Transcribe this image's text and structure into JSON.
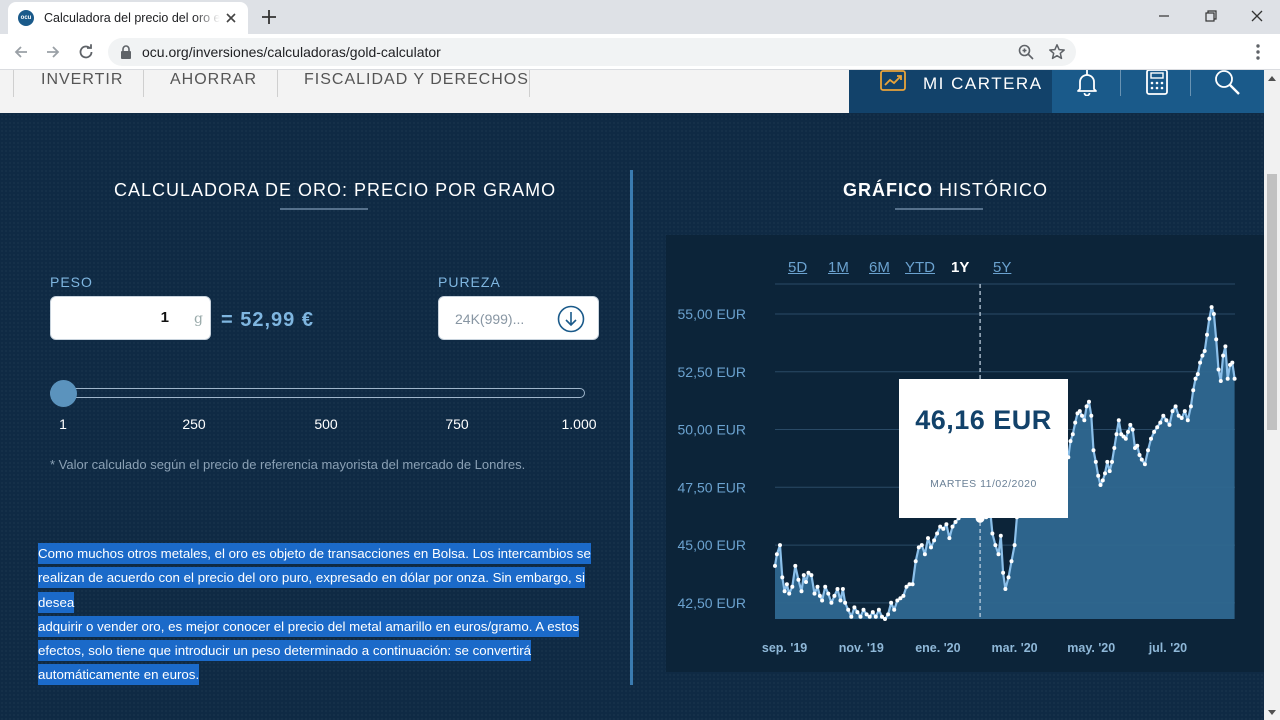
{
  "browser": {
    "tab_title": "Calculadora del precio del oro en",
    "favicon_text": "ocu",
    "url": "ocu.org/inversiones/calculadoras/gold-calculator"
  },
  "site_nav": {
    "items": [
      "INVERTIR",
      "AHORRAR",
      "FISCALIDAD Y DERECHOS"
    ],
    "cartera_label": "MI CARTERA"
  },
  "calculator": {
    "title": "CALCULADORA DE ORO: PRECIO POR GRAMO",
    "peso_label": "PESO",
    "peso_value": "1",
    "peso_unit": "g",
    "result": "= 52,99 €",
    "pureza_label": "PUREZA",
    "pureza_value": "24K(999)...",
    "slider_value": 1,
    "slider_ticks": [
      "1",
      "250",
      "500",
      "750",
      "1.000"
    ],
    "footnote": "* Valor calculado según el precio de referencia mayorista del mercado de Londres.",
    "paragraph_lines": [
      "Como muchos otros metales, el oro es objeto de transacciones en Bolsa. Los intercambios se",
      "realizan de acuerdo con el precio del oro puro, expresado en dólar por onza. Sin embargo, si desea",
      "adquirir o vender oro, es mejor conocer el precio del metal amarillo en euros/gramo. A estos",
      "efectos, solo tiene que introducir un peso determinado a continuación: se convertirá",
      "automáticamente en euros."
    ]
  },
  "history": {
    "title_bold": "GRÁFICO",
    "title_rest": " HISTÓRICO",
    "ranges": [
      "5D",
      "1M",
      "6M",
      "YTD",
      "1Y",
      "5Y"
    ],
    "active_range": "1Y",
    "tooltip_value": "46,16 EUR",
    "tooltip_date": "MARTES 11/02/2020"
  },
  "chart_data": {
    "type": "area",
    "y_unit": "EUR",
    "y_ticks": [
      "55,00 EUR",
      "52,50 EUR",
      "50,00 EUR",
      "47,50 EUR",
      "45,00 EUR",
      "42,50 EUR"
    ],
    "y_tick_values": [
      55,
      52.5,
      50,
      47.5,
      45,
      42.5
    ],
    "ylim": [
      41.8,
      56.3
    ],
    "x_ticks": [
      "sep. '19",
      "nov. '19",
      "ene. '20",
      "mar. '20",
      "may. '20",
      "jul. '20"
    ],
    "x_tick_months": [
      0,
      2,
      4,
      6,
      8,
      10
    ],
    "x_range_months": [
      -0.25,
      11.75
    ],
    "grid": true,
    "series": [
      {
        "months": [
          -0.25,
          -0.2,
          -0.12,
          -0.06,
          0.0,
          0.06,
          0.12,
          0.2,
          0.28,
          0.36,
          0.44,
          0.5,
          0.56,
          0.62,
          0.7,
          0.78,
          0.86,
          0.92,
          0.98,
          1.06,
          1.14,
          1.22,
          1.3,
          1.38,
          1.46,
          1.52,
          1.58,
          1.66,
          1.74,
          1.82,
          1.9,
          1.98,
          2.06,
          2.14,
          2.22,
          2.3,
          2.38,
          2.46,
          2.54,
          2.62,
          2.7,
          2.78,
          2.86,
          2.94,
          3.02,
          3.1,
          3.18,
          3.26,
          3.34,
          3.42,
          3.5,
          3.58,
          3.66,
          3.74,
          3.82,
          3.9,
          3.98,
          4.06,
          4.14,
          4.22,
          4.3,
          4.38,
          4.46,
          4.54,
          4.62,
          4.7,
          4.78,
          4.86,
          4.94,
          5.02,
          5.1,
          5.18,
          5.26,
          5.34,
          5.36,
          5.42,
          5.5,
          5.58,
          5.64,
          5.7,
          5.76,
          5.84,
          5.92,
          6.0,
          6.06,
          6.12,
          6.18,
          6.24,
          6.3,
          6.36,
          6.42,
          6.48,
          6.52,
          6.56,
          6.62,
          6.68,
          6.74,
          6.8,
          6.86,
          6.92,
          6.98,
          7.04,
          7.1,
          7.16,
          7.22,
          7.28,
          7.34,
          7.4,
          7.46,
          7.52,
          7.58,
          7.64,
          7.7,
          7.76,
          7.82,
          7.88,
          7.94,
          8.0,
          8.06,
          8.12,
          8.18,
          8.24,
          8.3,
          8.36,
          8.42,
          8.48,
          8.54,
          8.6,
          8.66,
          8.72,
          8.78,
          8.84,
          8.9,
          8.96,
          9.02,
          9.08,
          9.14,
          9.2,
          9.26,
          9.32,
          9.4,
          9.48,
          9.56,
          9.64,
          9.72,
          9.8,
          9.88,
          9.96,
          10.04,
          10.12,
          10.2,
          10.28,
          10.36,
          10.44,
          10.52,
          10.6,
          10.66,
          10.72,
          10.78,
          10.84,
          10.9,
          10.96,
          11.02,
          11.08,
          11.14,
          11.2,
          11.26,
          11.32,
          11.38,
          11.44,
          11.5,
          11.56,
          11.62,
          11.68,
          11.74
        ],
        "values": [
          44.1,
          44.6,
          45.0,
          43.6,
          43.0,
          43.3,
          42.9,
          43.2,
          44.1,
          43.5,
          43.0,
          43.7,
          43.4,
          43.8,
          43.7,
          42.9,
          43.2,
          42.8,
          42.6,
          43.2,
          42.9,
          42.5,
          42.8,
          43.1,
          42.6,
          43.1,
          42.5,
          42.2,
          41.9,
          42.3,
          42.1,
          41.9,
          42.2,
          42.0,
          41.9,
          42.1,
          41.9,
          42.2,
          41.9,
          41.8,
          42.0,
          42.5,
          42.2,
          42.6,
          42.7,
          42.8,
          43.2,
          43.3,
          43.3,
          44.3,
          44.9,
          45.0,
          44.6,
          45.3,
          44.9,
          45.2,
          45.5,
          45.8,
          45.7,
          45.9,
          45.3,
          45.8,
          46.0,
          46.16,
          46.6,
          47.0,
          47.2,
          47.8,
          48.1,
          47.9,
          47.0,
          46.6,
          46.2,
          47.2,
          46.6,
          45.5,
          45.0,
          44.6,
          45.4,
          43.8,
          43.1,
          43.6,
          44.3,
          45.0,
          46.2,
          46.4,
          47.2,
          47.7,
          48.1,
          48.6,
          48.3,
          48.9,
          48.7,
          49.4,
          50.2,
          50.6,
          51.0,
          50.1,
          49.2,
          49.4,
          49.7,
          50.3,
          49.9,
          50.4,
          50.1,
          49.3,
          49.2,
          48.8,
          49.5,
          49.8,
          50.3,
          50.7,
          50.8,
          50.6,
          50.4,
          51.0,
          51.2,
          50.6,
          49.1,
          48.6,
          48.0,
          47.6,
          47.8,
          48.1,
          48.6,
          48.2,
          48.6,
          49.2,
          49.8,
          50.4,
          49.8,
          49.7,
          49.6,
          49.9,
          50.2,
          50.0,
          49.2,
          49.3,
          48.9,
          48.7,
          48.5,
          49.1,
          49.6,
          49.9,
          50.1,
          50.3,
          50.6,
          50.4,
          50.2,
          50.8,
          51.0,
          50.6,
          50.5,
          50.8,
          50.4,
          51.0,
          51.7,
          52.2,
          52.4,
          52.9,
          53.2,
          53.4,
          54.1,
          54.8,
          55.3,
          55.0,
          53.9,
          52.6,
          52.1,
          53.2,
          53.6,
          52.2,
          52.8,
          52.9,
          52.2,
          52.6,
          52.8,
          52.4
        ]
      }
    ],
    "highlight_month": 5.1,
    "highlight_value": 46.16
  }
}
